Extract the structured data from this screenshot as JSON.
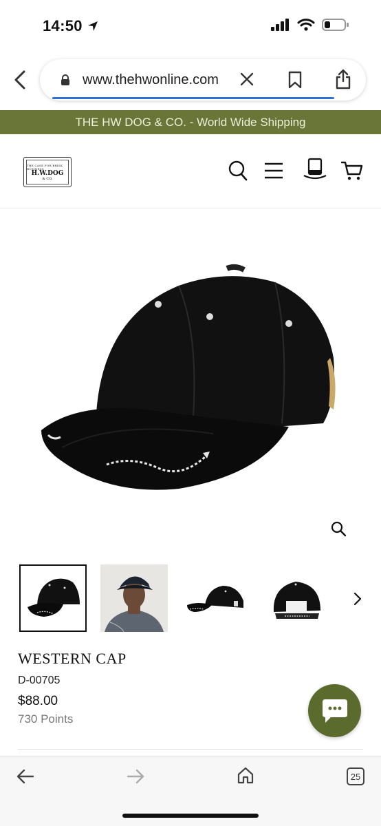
{
  "status_bar": {
    "time": "14:50"
  },
  "browser": {
    "url": "www.thehwonline.com",
    "tabs_count": "25"
  },
  "announcement": "THE HW DOG & CO. - World Wide Shipping",
  "header": {
    "logo": {
      "top_text": "THE CASE FOR BRISK BUSINESS",
      "main_text": "H.W.DOG",
      "sub_text": "& CO."
    }
  },
  "product": {
    "title": "WESTERN CAP",
    "sku": "D-00705",
    "price": "$88.00",
    "points": "730 Points",
    "thumbnail_count": 4,
    "selected_thumbnail": 1
  },
  "colors": {
    "announcement_bg": "#6a7638",
    "chat_button_bg": "#5b6b2e",
    "url_progress": "#2f6fd6"
  }
}
